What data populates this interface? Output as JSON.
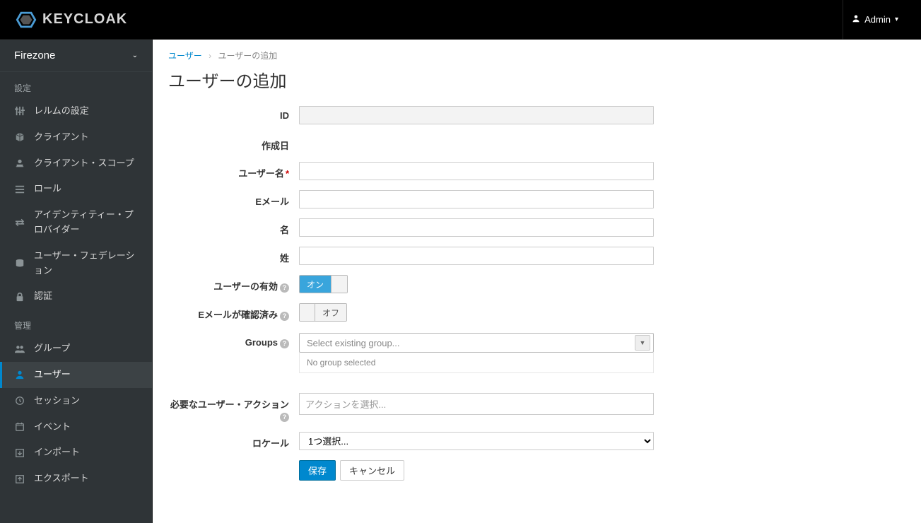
{
  "brand": "KEYCLOAK",
  "user_menu": {
    "label": "Admin"
  },
  "realm_selector": {
    "name": "Firezone"
  },
  "sidebar": {
    "section_configure": "設定",
    "section_manage": "管理",
    "configure_items": [
      {
        "label": "レルムの設定"
      },
      {
        "label": "クライアント"
      },
      {
        "label": "クライアント・スコープ"
      },
      {
        "label": "ロール"
      },
      {
        "label": "アイデンティティー・プロバイダー"
      },
      {
        "label": "ユーザー・フェデレーション"
      },
      {
        "label": "認証"
      }
    ],
    "manage_items": [
      {
        "label": "グループ"
      },
      {
        "label": "ユーザー"
      },
      {
        "label": "セッション"
      },
      {
        "label": "イベント"
      },
      {
        "label": "インポート"
      },
      {
        "label": "エクスポート"
      }
    ]
  },
  "breadcrumb": {
    "root": "ユーザー",
    "current": "ユーザーの追加"
  },
  "page_title": "ユーザーの追加",
  "form": {
    "id_label": "ID",
    "created_label": "作成日",
    "username_label": "ユーザー名",
    "email_label": "Eメール",
    "first_name_label": "名",
    "last_name_label": "姓",
    "enabled_label": "ユーザーの有効",
    "email_verified_label": "Eメールが確認済み",
    "groups_label": "Groups",
    "required_actions_label": "必要なユーザー・アクション",
    "locale_label": "ロケール",
    "toggle_on": "オン",
    "toggle_off": "オフ",
    "group_placeholder": "Select existing group...",
    "group_status": "No group selected",
    "actions_placeholder": "アクションを選択...",
    "locale_placeholder": "1つ選択...",
    "save": "保存",
    "cancel": "キャンセル"
  }
}
